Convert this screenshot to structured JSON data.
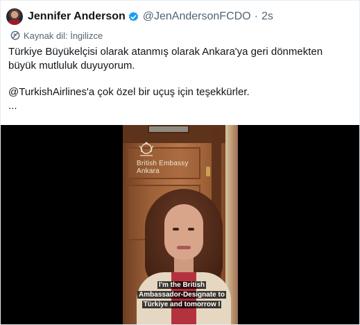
{
  "tweet": {
    "author": {
      "display_name": "Jennifer Anderson",
      "handle": "@JenAndersonFCDO",
      "separator": "·",
      "timestamp": "2s"
    },
    "translation_note": "Kaynak dil: İngilizce",
    "text_lines": [
      "Türkiye Büyükelçisi olarak atanmış olarak Ankara'ya geri dönmekten",
      "büyük mutluluk duyuyorum.",
      "@TurkishAirlines'a çok özel bir uçuş için teşekkürler.",
      "..."
    ]
  },
  "video": {
    "plaque": [
      "British Embassy",
      "Ankara"
    ],
    "caption_lines": [
      "I'm the British",
      "Ambassador-Designate to",
      "Türkiye  and tomorrow I"
    ]
  },
  "colors": {
    "text_primary": "#0f1419",
    "text_secondary": "#536471",
    "verified_blue": "#1d9bf0"
  },
  "icons": {
    "verified": "verified-badge-icon",
    "translate": "translate-icon"
  }
}
